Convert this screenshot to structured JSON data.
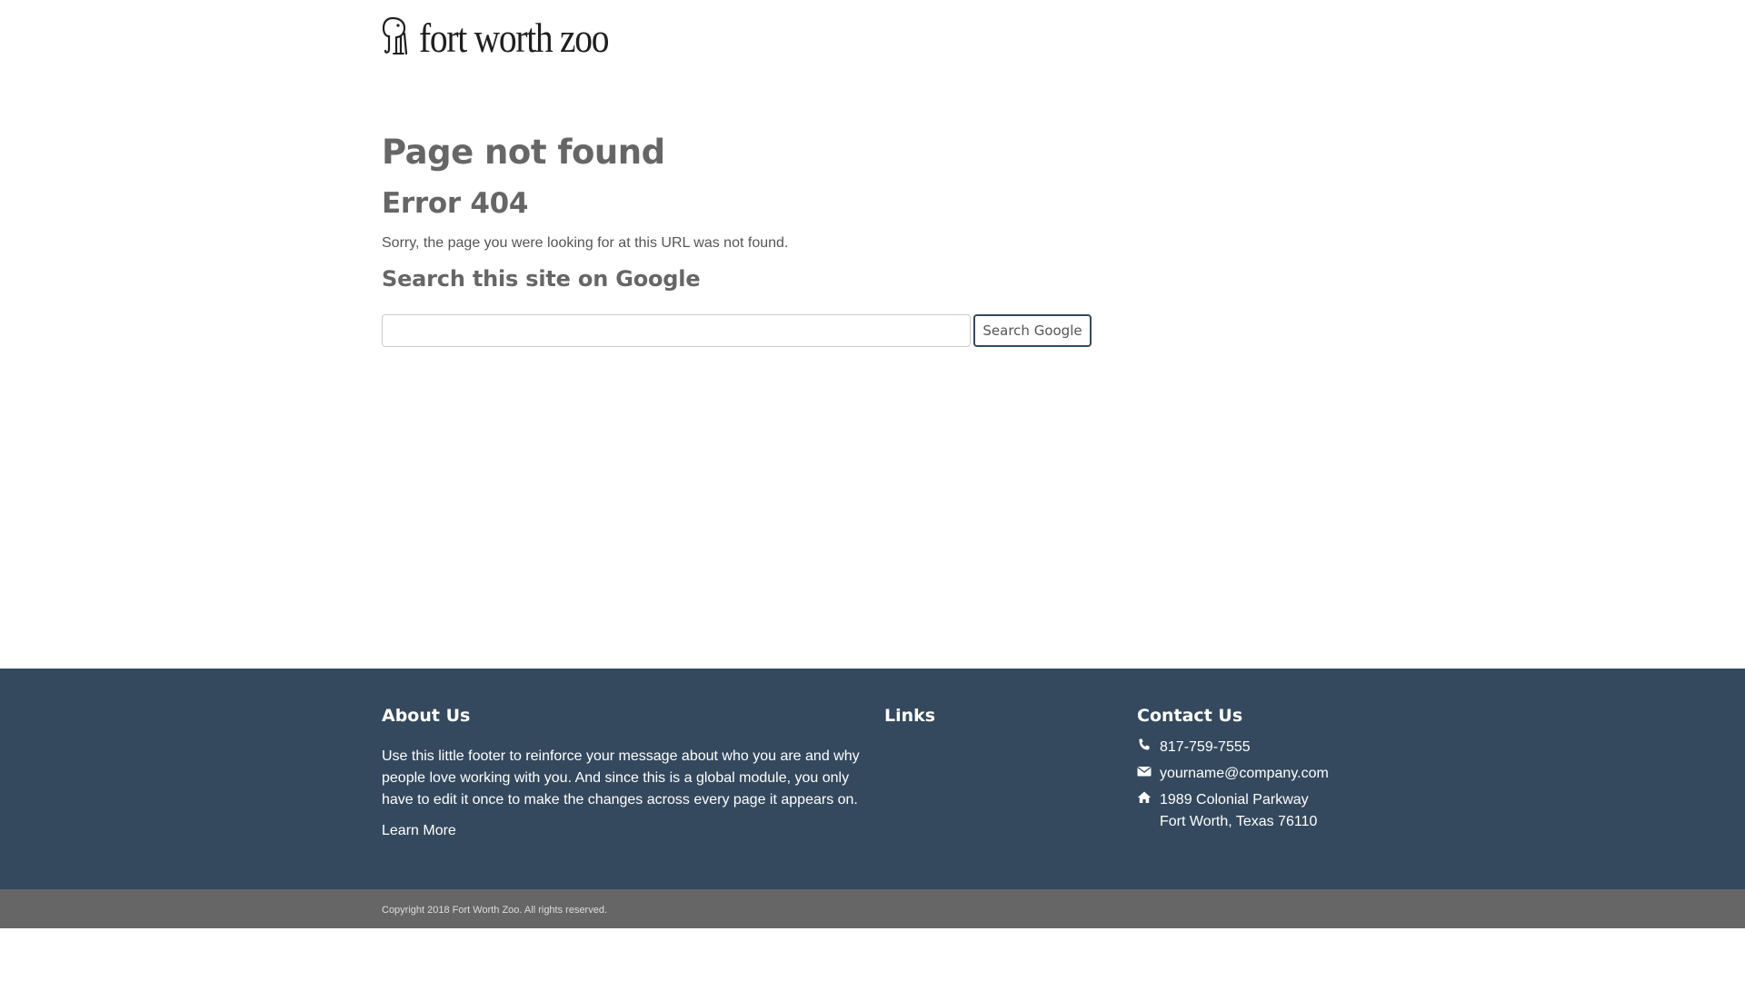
{
  "header": {
    "logo_text": "fort worth zoo"
  },
  "main": {
    "title": "Page not found",
    "error_code": "Error 404",
    "message": "Sorry, the page you were looking for at this URL was not found.",
    "search_heading": "Search this site on Google",
    "search_input_value": "",
    "search_button_label": "Search Google"
  },
  "footer": {
    "about": {
      "heading": "About Us",
      "text": "Use this little footer to reinforce your message about who you are and why people love working with you. And since this is a global module, you only have to edit it once to make the changes across every page it appears on.",
      "link_label": "Learn More"
    },
    "links": {
      "heading": "Links"
    },
    "contact": {
      "heading": "Contact Us",
      "phone": "817-759-7555",
      "email": "yourname@company.com",
      "address_line1": "1989 Colonial Parkway",
      "address_line2": "Fort Worth, Texas 76110"
    },
    "copyright": "Copyright 2018 Fort Worth Zoo. All rights reserved."
  },
  "colors": {
    "footer_bg": "#34495e",
    "copyright_bg": "#666666",
    "heading_gray": "#666666",
    "button_border": "#34495e"
  },
  "icons": {
    "logo": "elephant-icon",
    "phone": "phone-icon",
    "email": "envelope-icon",
    "address": "home-icon"
  }
}
